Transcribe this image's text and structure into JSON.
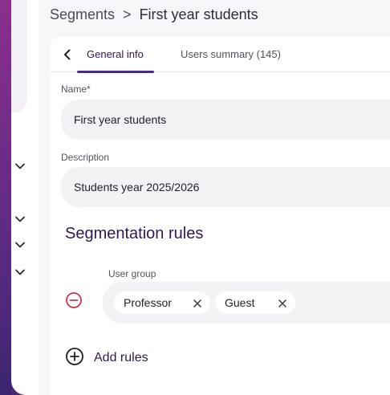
{
  "breadcrumb": {
    "root": "Segments",
    "separator": ">",
    "current": "First year students"
  },
  "tabs": [
    {
      "label": "General info",
      "active": true
    },
    {
      "label": "Users summary (145)",
      "active": false
    }
  ],
  "form": {
    "name_label": "Name*",
    "name_value": "First year students",
    "description_label": "Description",
    "description_value": "Students year 2025/2026"
  },
  "segmentation": {
    "title": "Segmentation rules",
    "rule_label": "User group",
    "chips": [
      "Professor",
      "Guest"
    ],
    "add_rules_label": "Add rules"
  },
  "icons": {
    "back": "chevron-left-icon",
    "remove": "minus-circle-icon",
    "add": "plus-circle-icon",
    "chip_remove": "close-icon",
    "sidebar_expand": "chevron-down-icon"
  },
  "colors": {
    "accent": "#4a2a8a",
    "danger": "#d0334a",
    "background_gradient_start": "#8a2f8e",
    "background_gradient_end": "#3a2670"
  }
}
